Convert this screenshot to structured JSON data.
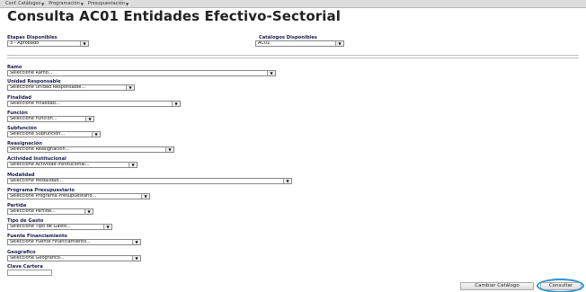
{
  "menu": [
    {
      "label": "Conf. Catálogos",
      "has_caret": true
    },
    {
      "label": "Programación",
      "has_caret": true
    },
    {
      "label": "Presupuestación",
      "has_caret": true
    }
  ],
  "page_title": "Consulta AC01 Entidades Efectivo-Sectorial",
  "etapas": {
    "label": "Etapas Disponibles",
    "value": "3 - Aprobado"
  },
  "catalogos": {
    "label": "Catálogos Disponibles",
    "value": "AC01"
  },
  "filters": {
    "ramo": {
      "label": "Ramo",
      "value": "Seleccione Ramo..."
    },
    "unidad": {
      "label": "Unidad Responsable",
      "value": "Seleccione Unidad Responsable..."
    },
    "finalidad": {
      "label": "Finalidad",
      "value": "Seleccione Finalidad..."
    },
    "funcion": {
      "label": "Función",
      "value": "Seleccione Función..."
    },
    "subfuncion": {
      "label": "Subfunción",
      "value": "Seleccione Subfunción..."
    },
    "reasignacion": {
      "label": "Reasignación",
      "value": "Seleccione Reasignación..."
    },
    "actividad": {
      "label": "Actividad Institucional",
      "value": "Seleccione Actividad Institucional..."
    },
    "modalidad": {
      "label": "Modalidad",
      "value": "Seleccione Modalidad..."
    },
    "programa": {
      "label": "Programa Presupuestario",
      "value": "Seleccione Programa Presupuestario..."
    },
    "partida": {
      "label": "Partida",
      "value": "Seleccione Partida..."
    },
    "tipo_gasto": {
      "label": "Tipo de Gasto",
      "value": "Seleccione Tipo de Gasto..."
    },
    "fuente": {
      "label": "Fuente Financiamiento",
      "value": "Seleccione Fuente Financiamiento..."
    },
    "geografico": {
      "label": "Geografico",
      "value": "Seleccione Geografico..."
    },
    "clave_cartera": {
      "label": "Clave Cartera",
      "value": ""
    }
  },
  "buttons": {
    "cambiar": "Cambiar Catálogo",
    "consultar": "Consultar"
  },
  "colors": {
    "highlight_ring": "#2e95d3",
    "label_text": "#1b1b4d"
  }
}
